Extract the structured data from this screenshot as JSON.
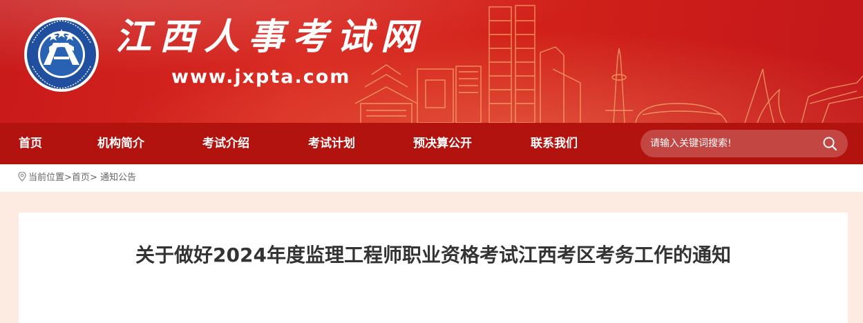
{
  "banner": {
    "site_title": "江西人事考试网",
    "site_url": "www.jxpta.com",
    "logo_text": "江西省人事考试中心 Personnel Testing Center of Jiangxi Province"
  },
  "nav": {
    "items": [
      {
        "label": "首页"
      },
      {
        "label": "机构简介"
      },
      {
        "label": "考试介绍"
      },
      {
        "label": "考试计划"
      },
      {
        "label": "预决算公开"
      },
      {
        "label": "联系我们"
      }
    ],
    "search": {
      "placeholder": "请输入关键词搜索!"
    }
  },
  "breadcrumb": {
    "prefix": "当前位置",
    "separator": ">",
    "home": "首页",
    "current": "通知公告"
  },
  "article": {
    "title": "关于做好2024年度监理工程师职业资格考试江西考区考务工作的通知"
  },
  "colors": {
    "banner_red": "#d22119",
    "nav_red": "#b3130f",
    "page_bg": "#fdebe2",
    "title_text": "#333333"
  }
}
